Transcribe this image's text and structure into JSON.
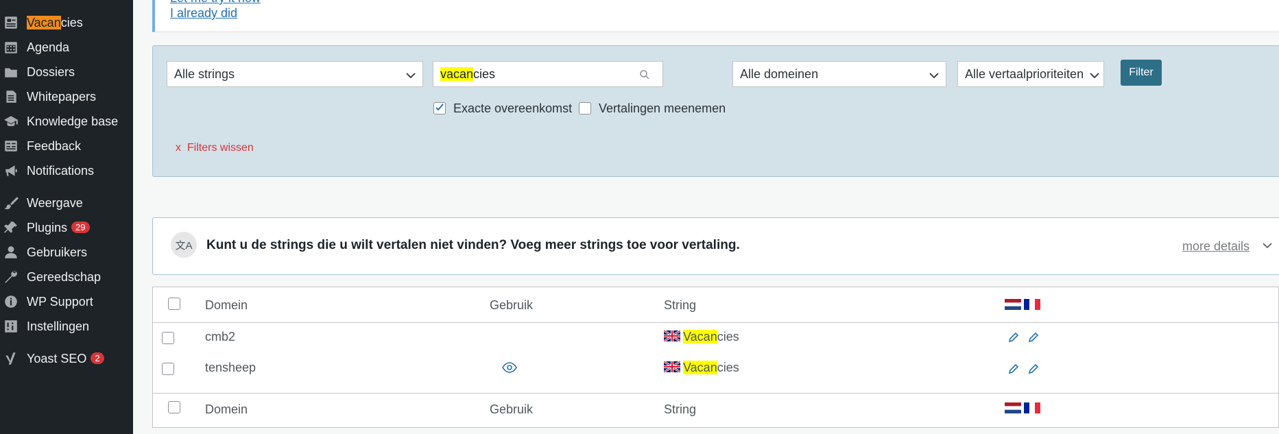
{
  "sidebar": {
    "items": [
      {
        "label": "Vacancies",
        "highlight": "Vacan",
        "rest": "cies",
        "icon": "vacancies-icon"
      },
      {
        "label": "Agenda",
        "icon": "calendar-icon"
      },
      {
        "label": "Dossiers",
        "icon": "folder-icon"
      },
      {
        "label": "Whitepapers",
        "icon": "document-icon"
      },
      {
        "label": "Knowledge base",
        "icon": "graduation-cap-icon"
      },
      {
        "label": "Feedback",
        "icon": "feedback-icon"
      },
      {
        "label": "Notifications",
        "icon": "megaphone-icon"
      },
      {
        "label": "Weergave",
        "icon": "brush-icon"
      },
      {
        "label": "Plugins",
        "icon": "plugin-icon",
        "badge": "29"
      },
      {
        "label": "Gebruikers",
        "icon": "user-icon"
      },
      {
        "label": "Gereedschap",
        "icon": "wrench-icon"
      },
      {
        "label": "WP Support",
        "icon": "info-icon"
      },
      {
        "label": "Instellingen",
        "icon": "settings-icon"
      },
      {
        "label": "Yoast SEO",
        "icon": "yoast-icon",
        "badge": "2"
      }
    ]
  },
  "notice": {
    "link_partial": "Let me try it now",
    "link": "I already did"
  },
  "filters": {
    "strings_select": "Alle strings",
    "search_highlight": "vacan",
    "search_rest": "cies",
    "domains_select": "Alle domeinen",
    "priorities_select": "Alle vertaalprioriteiten",
    "filter_button": "Filter",
    "exact_match_label": "Exacte overeenkomst",
    "exact_match_checked": true,
    "include_translations_label": "Vertalingen meenemen",
    "include_translations_checked": false,
    "clear_prefix": "x",
    "clear_label": "Filters wissen"
  },
  "help": {
    "icon_text": "文A",
    "text": "Kunt u de strings die u wilt vertalen niet vinden? Voeg meer strings toe voor vertaling.",
    "more_details": "more details"
  },
  "table": {
    "columns": {
      "domain": "Domein",
      "usage": "Gebruik",
      "string": "String"
    },
    "rows": [
      {
        "domain": "cmb2",
        "string_highlight": "Vacan",
        "string_rest": "cies",
        "usage_icon": false
      },
      {
        "domain": "tensheep",
        "string_highlight": "Vacan",
        "string_rest": "cies",
        "usage_icon": true
      }
    ],
    "language_flags": [
      "nl-flag-icon",
      "fr-flag-icon"
    ]
  },
  "colors": {
    "sidebar_bg": "#1d2327",
    "accent_orange": "#f18b1a",
    "filter_bg": "#d3e1e8",
    "filter_button": "#2d6f86",
    "search_highlight": "#ffff00",
    "badge_red": "#d63638"
  }
}
